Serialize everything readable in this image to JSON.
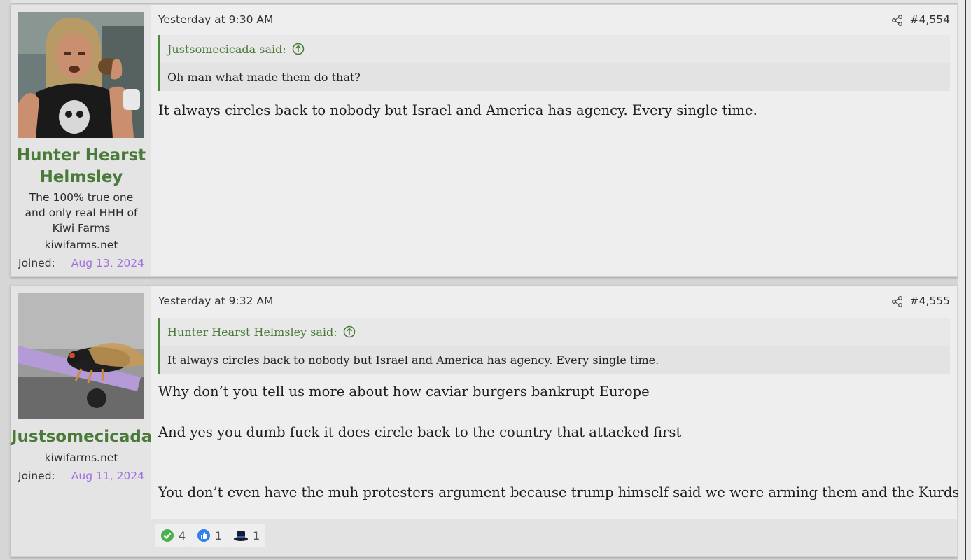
{
  "posts": [
    {
      "user": {
        "name_line1": "Hunter Hearst",
        "name_line2": "Helmsley",
        "title": "The 100% true one and only real HHH of Kiwi Farms",
        "site": "kiwifarms.net",
        "joined_label": "Joined:",
        "joined_date": "Aug 13, 2024"
      },
      "time": "Yesterday at 9:30 AM",
      "post_number": "#4,554",
      "quote": {
        "author": "Justsomecicada said:",
        "text": "Oh man what made them do that?"
      },
      "message": [
        "It always circles back to nobody but Israel and America has agency. Every single time."
      ]
    },
    {
      "user": {
        "name": "Justsomecicada",
        "site": "kiwifarms.net",
        "joined_label": "Joined:",
        "joined_date": "Aug 11, 2024"
      },
      "time": "Yesterday at 9:32 AM",
      "post_number": "#4,555",
      "quote": {
        "author": "Hunter Hearst Helmsley said:",
        "text": "It always circles back to nobody but Israel and America has agency. Every single time."
      },
      "message": [
        "Why don’t you tell us more about how caviar burgers bankrupt Europe",
        "And yes you dumb fuck it does circle back to the country that attacked first",
        "You don’t even have the muh protesters argument because trump himself said we were arming them and the Kurds"
      ],
      "reactions": [
        {
          "icon": "checkmark-reaction-icon",
          "count": "4"
        },
        {
          "icon": "thumbs-up-reaction-icon",
          "count": "1"
        },
        {
          "icon": "top-hat-reaction-icon",
          "count": "1"
        }
      ]
    }
  ],
  "colors": {
    "username": "#4a7a3a",
    "joined_date": "#a16fe0",
    "quote_border": "#4a8a3a"
  }
}
